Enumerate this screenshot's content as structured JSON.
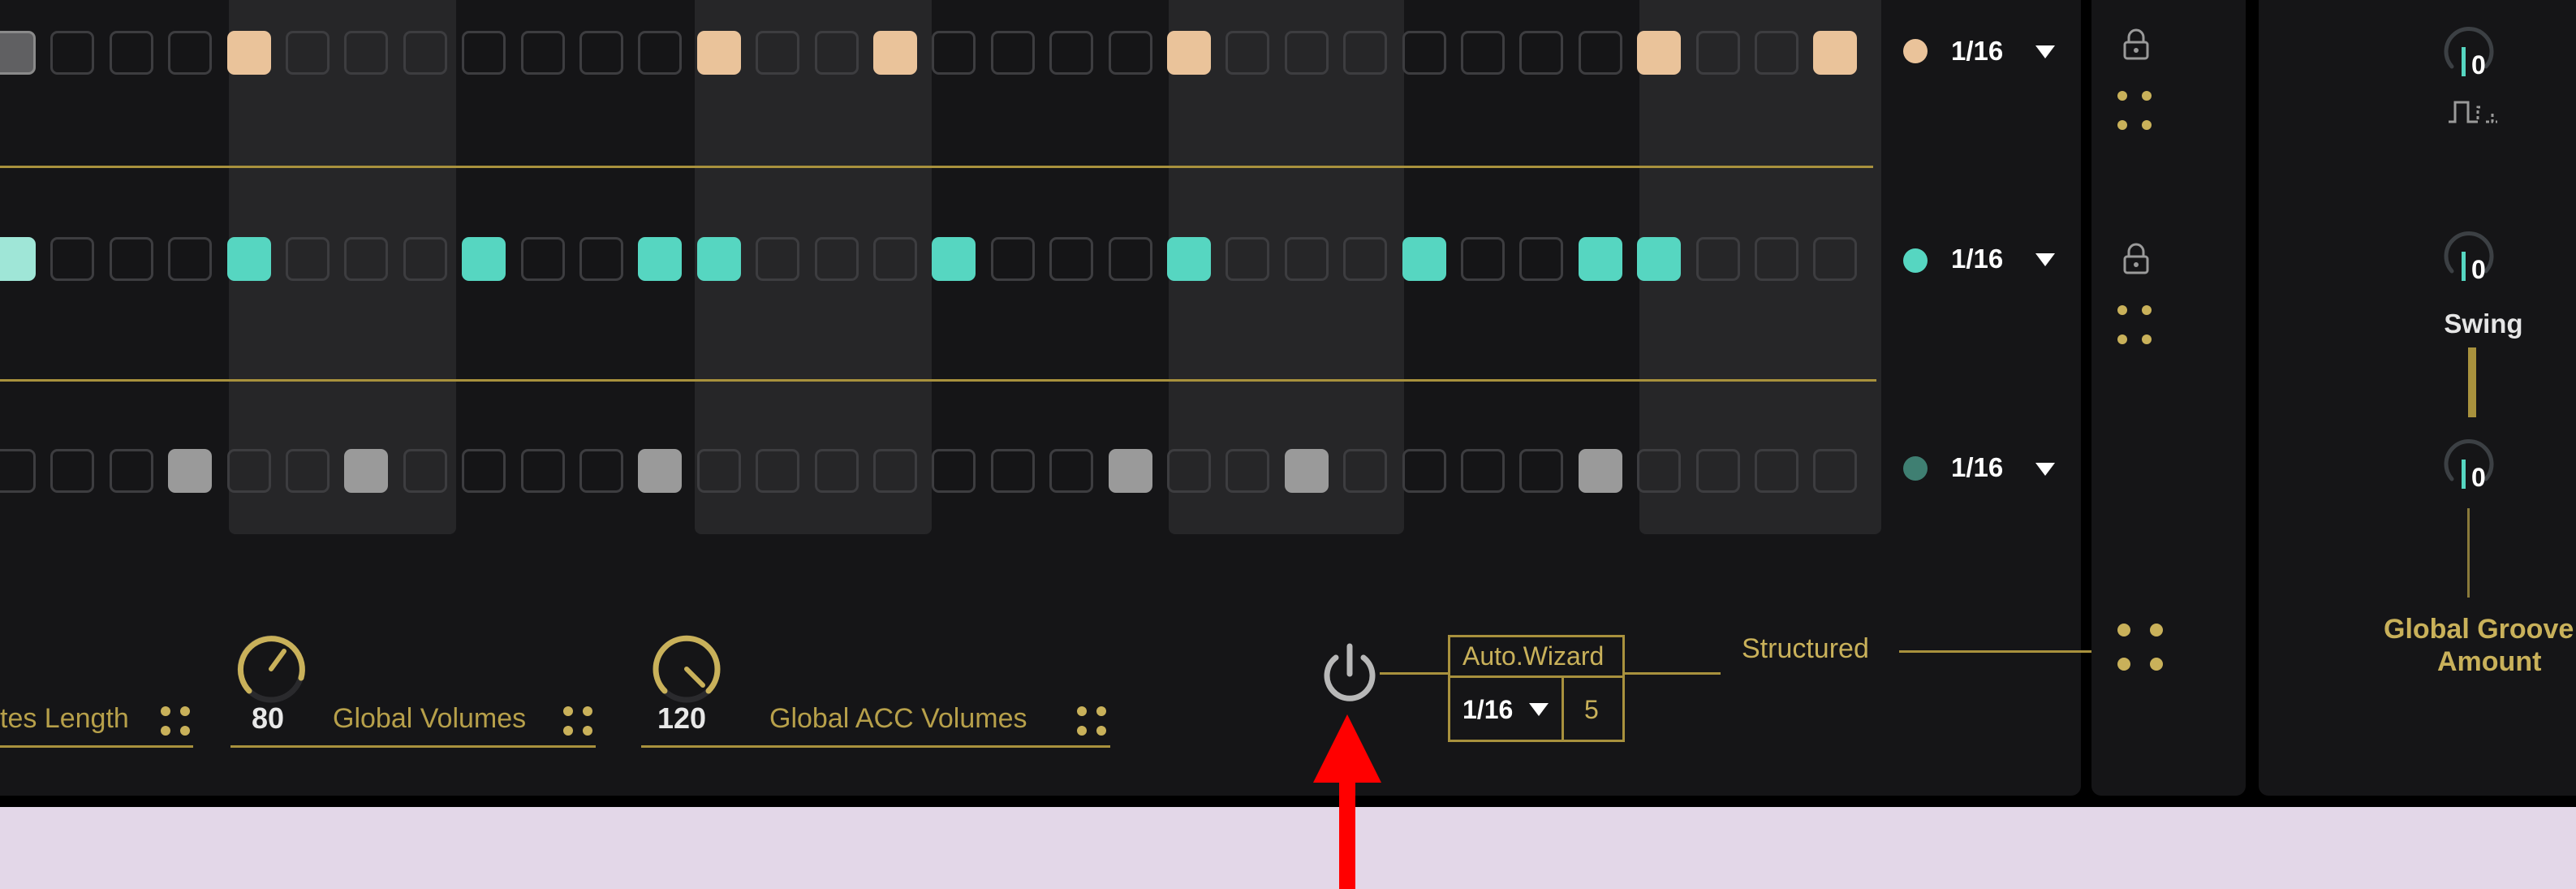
{
  "sequencer": {
    "lanes": [
      {
        "name": "lane-1",
        "color": "#eac39a",
        "rate": "1/16"
      },
      {
        "name": "lane-2",
        "color": "#56d6c1",
        "rate": "1/16"
      },
      {
        "name": "lane-3",
        "color": "#3f7f72",
        "rate": "1/16"
      }
    ]
  },
  "footer": {
    "notes_length_label": "tes Length",
    "global_volumes_value": "80",
    "global_volumes_label": "Global Volumes",
    "global_acc_volumes_value": "120",
    "global_acc_volumes_label": "Global ACC Volumes",
    "auto_wizard_title": "Auto.Wizard",
    "auto_wizard_rate": "1/16",
    "auto_wizard_count": "5",
    "mode_label": "Structured"
  },
  "right_panel": {
    "knob1_value": "0",
    "knob2_value": "0",
    "swing_label": "Swing",
    "knob3_value": "0",
    "groove_label_line1": "Global Groove",
    "groove_label_line2": "Amount"
  },
  "icons": [
    "lock-icon",
    "grip-icon",
    "power-icon",
    "caret-down-icon",
    "pulse-shape-icon"
  ],
  "colors": {
    "accent_gold": "#c9b15a",
    "peach": "#eac39a",
    "teal": "#56d6c1",
    "background": "#151517",
    "arrow": "#ff0000"
  }
}
